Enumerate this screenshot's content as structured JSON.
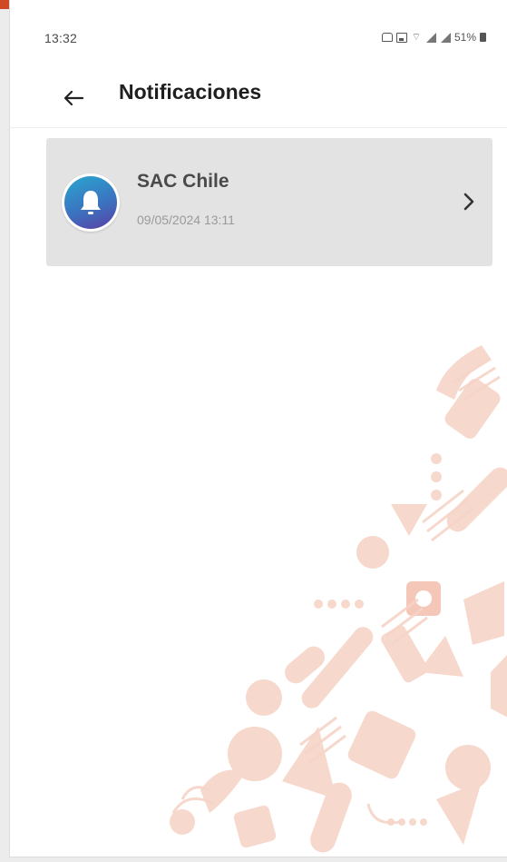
{
  "status_bar": {
    "time": "13:32",
    "battery": "51%"
  },
  "app_bar": {
    "title": "Notificaciones",
    "back_icon": "arrow-left-icon"
  },
  "notifications": [
    {
      "title": "SAC Chile",
      "date": "09/05/2024 13:11",
      "icon": "bell-icon",
      "chevron_icon": "chevron-right-icon"
    }
  ],
  "colors": {
    "card_background": "#e3e3e3",
    "avatar_gradient_start": "#2aa6cf",
    "avatar_gradient_end": "#5a3fa6",
    "background_pattern": "#f6d2c5",
    "accent": "#d14a27"
  }
}
